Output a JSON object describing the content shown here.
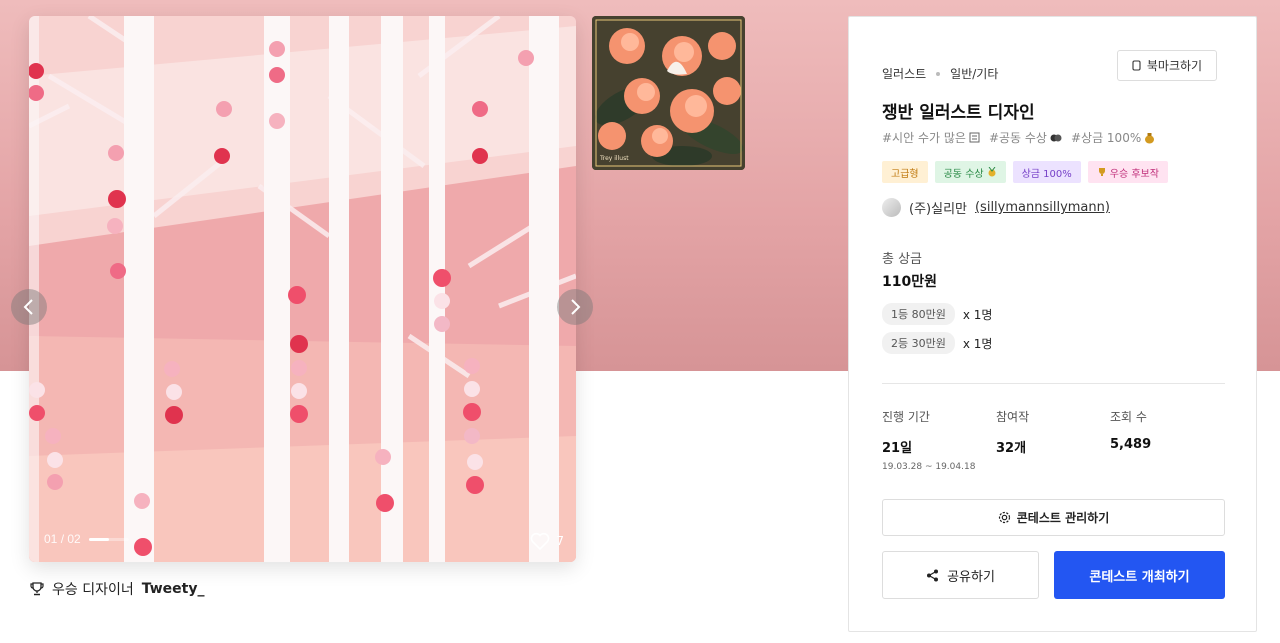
{
  "gallery": {
    "counter_current": "01",
    "counter_total": "/ 02",
    "progress": 0.5,
    "likes": "7",
    "thumb_caption": "Trey illust"
  },
  "winner": {
    "prefix": "우승 디자이너",
    "name": "Tweety_"
  },
  "contest": {
    "category": "일러스트",
    "subcategory": "일반/기타",
    "bookmark_label": "북마크하기",
    "title": "쟁반 일러스트 디자인",
    "hashtags": [
      "#시안 수가 많은",
      "#공동 수상",
      "#상금 100%"
    ],
    "badges": [
      "고급형",
      "공동 수상",
      "상금 100%",
      "우승 후보작"
    ],
    "host": "(주)실리만",
    "host_link": "(sillymannsillymann)",
    "prize_label": "총 상금",
    "prize_total": "110만원",
    "tiers": [
      {
        "label": "1등 80만원",
        "count": "x 1명"
      },
      {
        "label": "2등 30만원",
        "count": "x 1명"
      }
    ],
    "stats": {
      "period_label": "진행 기간",
      "period_value": "21일",
      "period_dates": "19.03.28 ~ 19.04.18",
      "entries_label": "참여작",
      "entries_value": "32개",
      "views_label": "조회 수",
      "views_value": "5,489"
    },
    "manage_label": "콘테스트 관리하기",
    "share_label": "공유하기",
    "host_contest_label": "콘테스트 개최하기"
  },
  "colors": {
    "primary": "#2356f2",
    "hero": "#e3a3a5"
  }
}
